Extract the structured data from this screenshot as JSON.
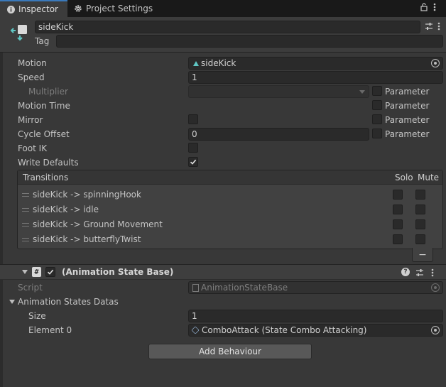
{
  "tabs": [
    {
      "label": "Inspector",
      "icon": "info-icon",
      "active": true
    },
    {
      "label": "Project Settings",
      "icon": "gear-icon",
      "active": false
    }
  ],
  "header": {
    "object_name": "sideKick",
    "tag_label": "Tag",
    "tag_value": ""
  },
  "state": {
    "motion_label": "Motion",
    "motion_value": "sideKick",
    "speed_label": "Speed",
    "speed_value": "1",
    "multiplier_label": "Multiplier",
    "multiplier_value": "",
    "motion_time_label": "Motion Time",
    "mirror_label": "Mirror",
    "cycle_offset_label": "Cycle Offset",
    "cycle_offset_value": "0",
    "foot_ik_label": "Foot IK",
    "write_defaults_label": "Write Defaults",
    "parameter_label": "Parameter",
    "mirror_checked": false,
    "foot_ik_checked": false,
    "write_defaults_checked": true
  },
  "transitions": {
    "header": "Transitions",
    "solo_label": "Solo",
    "mute_label": "Mute",
    "rows": [
      {
        "label": "sideKick -> spinningHook"
      },
      {
        "label": "sideKick -> idle"
      },
      {
        "label": "sideKick -> Ground Movement"
      },
      {
        "label": "sideKick -> butterflyTwist"
      }
    ],
    "remove_label": "−"
  },
  "component": {
    "title": "(Animation State Base)",
    "enabled": true,
    "script_label": "Script",
    "script_value": "AnimationStateBase",
    "list_label": "Animation States Datas",
    "size_label": "Size",
    "size_value": "1",
    "element_label": "Element 0",
    "element_value": "ComboAttack (State Combo Attacking)"
  },
  "add_behaviour_label": "Add Behaviour",
  "colors": {
    "accent": "#3a79bb",
    "check": "#e0e0e0"
  }
}
